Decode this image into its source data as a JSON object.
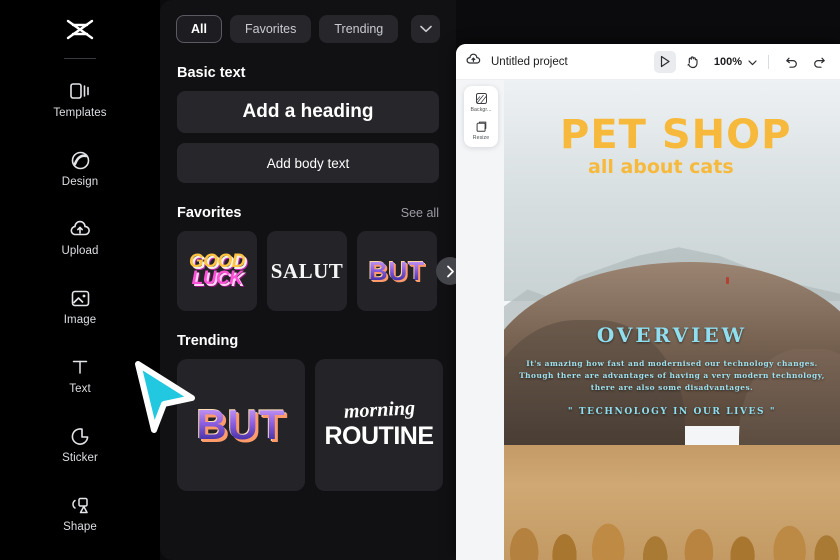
{
  "rail": {
    "logo_icon": "capcut-logo-icon",
    "items": [
      {
        "label": "Templates",
        "icon": "templates-icon"
      },
      {
        "label": "Design",
        "icon": "design-icon"
      },
      {
        "label": "Upload",
        "icon": "upload-cloud-icon"
      },
      {
        "label": "Image",
        "icon": "image-icon"
      },
      {
        "label": "Text",
        "icon": "text-t-icon"
      },
      {
        "label": "Sticker",
        "icon": "sticker-icon"
      },
      {
        "label": "Shape",
        "icon": "shape-icon"
      }
    ]
  },
  "panel": {
    "chips": [
      {
        "label": "All",
        "active": true
      },
      {
        "label": "Favorites",
        "active": false
      },
      {
        "label": "Trending",
        "active": false
      }
    ],
    "more_icon": "chevron-down-icon",
    "basic_text": {
      "title": "Basic text",
      "heading_btn": "Add a heading",
      "body_btn": "Add body text"
    },
    "favorites": {
      "title": "Favorites",
      "see_all": "See all",
      "next_icon": "chevron-right-icon",
      "tiles": [
        {
          "name": "good-luck",
          "line1": "GOOD",
          "line2": "LUCK"
        },
        {
          "name": "salut",
          "line1": "SALUT"
        },
        {
          "name": "but",
          "line1": "BUT"
        }
      ]
    },
    "trending": {
      "title": "Trending",
      "tiles": [
        {
          "name": "but-large",
          "line1": "BUT"
        },
        {
          "name": "morning-routine",
          "line1": "morning",
          "line2": "ROUTINE"
        }
      ]
    }
  },
  "editor": {
    "cloud_icon": "cloud-save-icon",
    "project_title": "Untitled project",
    "tools": [
      {
        "name": "select-tool",
        "icon": "cursor-arrow-icon",
        "active": true
      },
      {
        "name": "hand-tool",
        "icon": "hand-icon",
        "active": false
      }
    ],
    "zoom_level": "100%",
    "zoom_chevron_icon": "chevron-down-icon",
    "undo_icon": "undo-arrow-icon",
    "redo_icon": "redo-arrow-icon",
    "side_tools": [
      {
        "label": "Backgr...",
        "icon": "background-icon"
      },
      {
        "label": "Resize",
        "icon": "resize-icon"
      }
    ],
    "canvas": {
      "headline": "PET SHOP",
      "subhead": "all about cats",
      "overview_title": "OVERVIEW",
      "overview_body": "It's amazing how fast and modernised our technology changes. Though there are advantages of having a very modern technology, there are also some disadvantages.",
      "overview_quote": "\" TECHNOLOGY IN OUR LIVES \""
    }
  },
  "colors": {
    "rail_bg": "#000000",
    "panel_bg": "#111114",
    "chip_bg": "#26262b",
    "accent_yellow": "#f6b93b",
    "accent_cyan": "#8fdff0",
    "cursor_cyan": "#22c8e0",
    "editor_bg": "#ffffff"
  }
}
